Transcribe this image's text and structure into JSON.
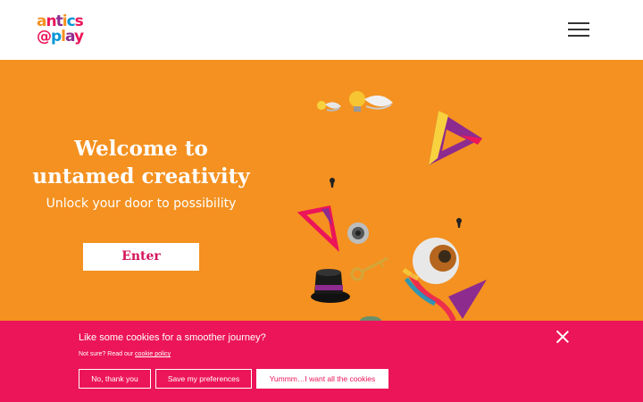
{
  "header": {
    "logo_line1": "antics",
    "logo_line2": "@play",
    "colors": {
      "logo_a": "#f49120",
      "logo_n": "#ec1559",
      "logo_t": "#8e2b8f",
      "logo_p": "#0096d6"
    }
  },
  "hero": {
    "title": "Welcome to untamed creativity",
    "subtitle": "Unlock your door to possibility",
    "enter_label": "Enter",
    "background": "#f49120"
  },
  "cookie": {
    "title": "Like some cookies for a smoother journey?",
    "sub_prefix": "Not sure? Read our ",
    "policy_link": "cookie policy",
    "btn_no": "No, thank you",
    "btn_save": "Save my preferences",
    "btn_yes": "Yummm…I want all the cookies",
    "background": "#ec1559"
  },
  "icons": [
    "hamburger-menu-icon",
    "close-icon",
    "light-bulb-icon",
    "keyhole-icon",
    "eyeball-icon",
    "top-hat-icon",
    "key-icon",
    "triangle-icon"
  ]
}
